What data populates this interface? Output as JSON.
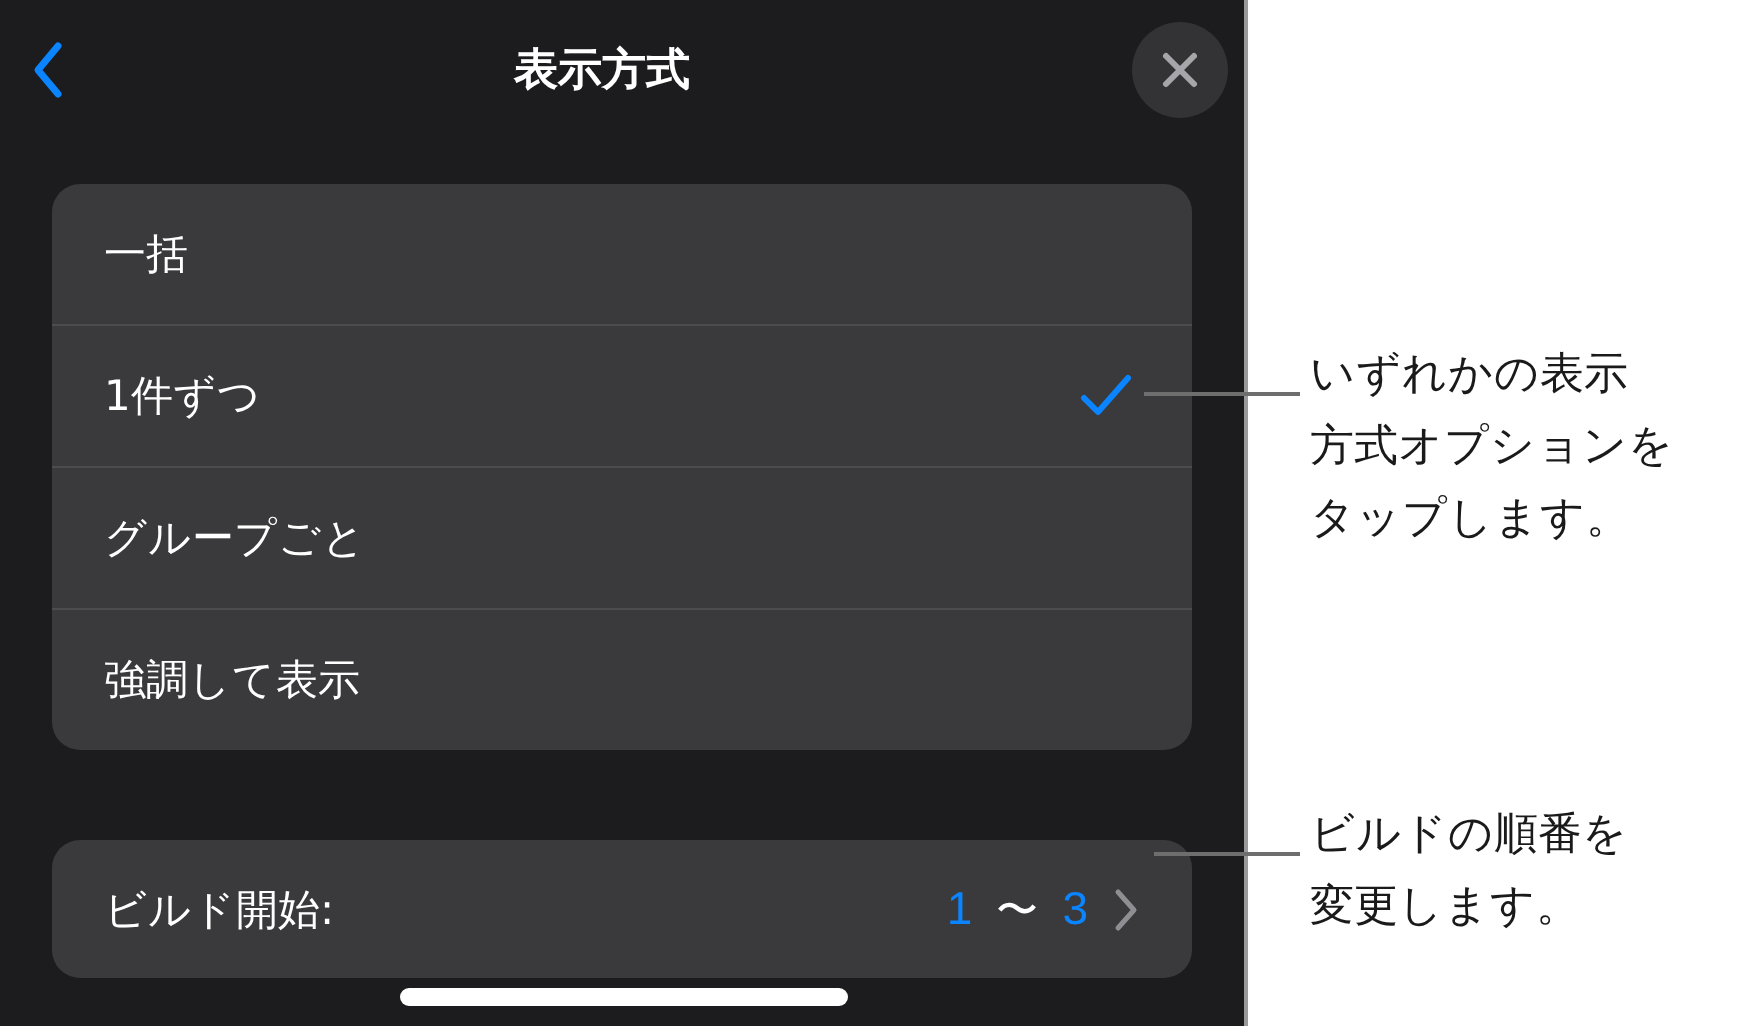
{
  "header": {
    "title": "表示方式"
  },
  "options": [
    {
      "label": "一括",
      "selected": false
    },
    {
      "label": "1件ずつ",
      "selected": true
    },
    {
      "label": "グループごと",
      "selected": false
    },
    {
      "label": "強調して表示",
      "selected": false
    }
  ],
  "build": {
    "label": "ビルド開始:",
    "from": "1",
    "separator": "〜",
    "to": "3"
  },
  "callouts": [
    {
      "lines": [
        "いずれかの表示",
        "方式オプションを",
        "タップします。"
      ]
    },
    {
      "lines": [
        "ビルドの順番を",
        "変更します。"
      ]
    }
  ]
}
